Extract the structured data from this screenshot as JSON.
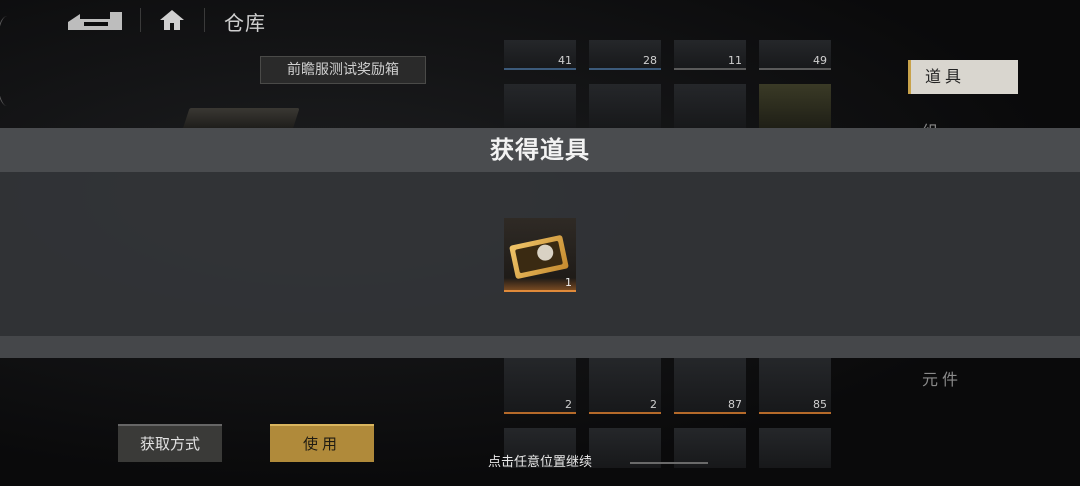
{
  "header": {
    "title": "仓库",
    "back_icon": "back-arrow-icon",
    "home_icon": "home-icon"
  },
  "selected_item": {
    "name": "前瞻服测试奖励箱"
  },
  "inventory": {
    "counts_top": [
      "41",
      "28",
      "11",
      "49"
    ],
    "counts_bottom": [
      "2",
      "2",
      "87",
      "85"
    ]
  },
  "categories": {
    "active": "道具",
    "partial": "组",
    "other": "元件"
  },
  "actions": {
    "acquire_label": "获取方式",
    "use_label": "使用"
  },
  "modal": {
    "title": "获得道具",
    "reward": {
      "count": "1",
      "icon": "ticket-icon"
    }
  },
  "hint": "点击任意位置继续",
  "colors": {
    "accent": "#c8a24a",
    "reward_glow": "#e08a3a",
    "use_button": "#b08a3a"
  }
}
